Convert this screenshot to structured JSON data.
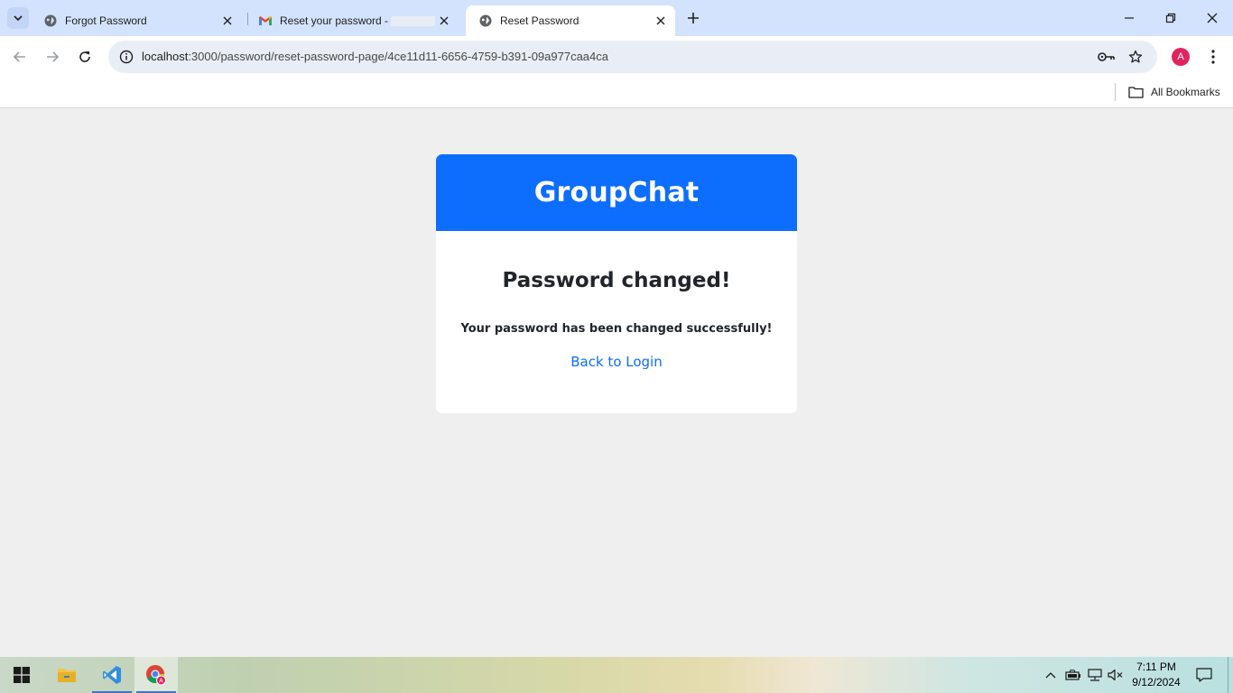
{
  "browser": {
    "tabs": [
      {
        "title": "Forgot Password",
        "icon": "globe-icon",
        "active": false
      },
      {
        "title": "Reset your password -",
        "icon": "gmail-icon",
        "active": false
      },
      {
        "title": "Reset Password",
        "icon": "globe-icon",
        "active": true
      }
    ],
    "url": {
      "host": "localhost",
      "rest": ":3000/password/reset-password-page/4ce11d11-6656-4759-b391-09a977caa4ca"
    },
    "profile_initial": "A",
    "bookmarks_label": "All Bookmarks"
  },
  "page": {
    "brand": "GroupChat",
    "heading": "Password changed!",
    "message": "Your password has been changed successfully!",
    "link": "Back to Login",
    "colors": {
      "primary": "#0d6efd",
      "background": "#efefef",
      "card": "#ffffff"
    }
  },
  "taskbar": {
    "apps": [
      "windows-start",
      "file-explorer",
      "vs-code",
      "chrome"
    ],
    "time": "7:11 PM",
    "date": "9/12/2024"
  }
}
